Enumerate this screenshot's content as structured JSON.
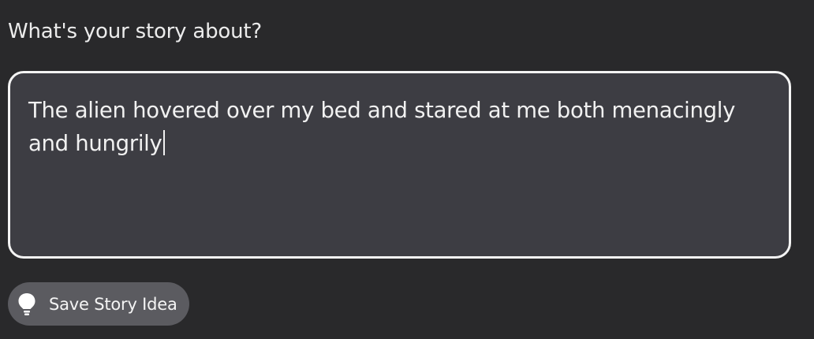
{
  "prompt": {
    "label": "What's your story about?"
  },
  "story_input": {
    "value": "The alien hovered over my bed and stared at me both menacingly and hungrily"
  },
  "save_button": {
    "label": "Save Story Idea",
    "icon": "lightbulb-icon"
  },
  "colors": {
    "background": "#29292b",
    "input_background": "#3d3d43",
    "input_border": "#f4f4f4",
    "button_background": "#5b5b60",
    "text": "#f1f1f1"
  }
}
